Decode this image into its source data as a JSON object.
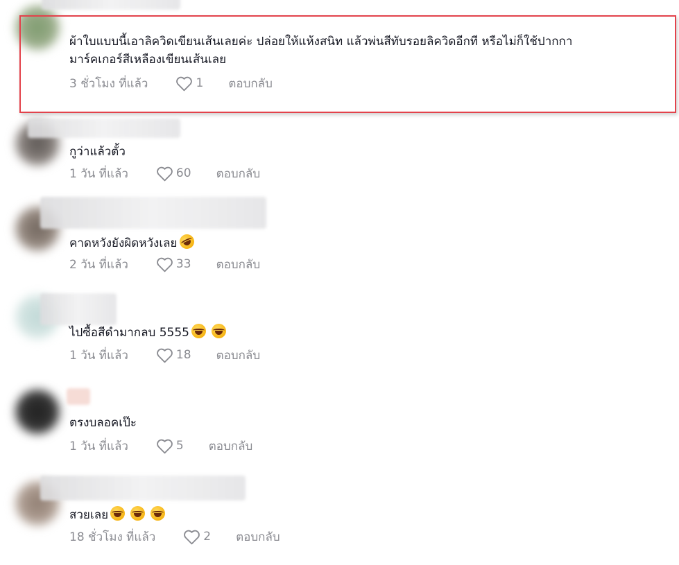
{
  "comments": [
    {
      "text_line1": "ผ้าใบแบบนี้เอาลิควิดเขียนเส้นเลยค่ะ ปล่อยให้แห้งสนิท แล้วพ่นสีทับรอยลิควิดอีกที หรือไม่ก็ใช้ปากกา",
      "text_line2": "มาร์คเกอร์สีเหลืองเขียนเส้นเลย",
      "time": "3 ชั่วโมง ที่แล้ว",
      "likes": "1",
      "reply": "ตอบกลับ"
    },
    {
      "text": "กูว่าแล้วตั้ว",
      "time": "1 วัน ที่แล้ว",
      "likes": "60",
      "reply": "ตอบกลับ"
    },
    {
      "text": "คาดหวังยังผิดหวังเลย",
      "time": "2 วัน ที่แล้ว",
      "likes": "33",
      "reply": "ตอบกลับ"
    },
    {
      "text": "ไปซื้อสีดำมากลบ 5555",
      "time": "1 วัน ที่แล้ว",
      "likes": "18",
      "reply": "ตอบกลับ"
    },
    {
      "text": "ตรงบลอคเป๊ะ",
      "time": "1 วัน ที่แล้ว",
      "likes": "5",
      "reply": "ตอบกลับ"
    },
    {
      "text": "สวยเลย",
      "time": "18 ชั่วโมง ที่แล้ว",
      "likes": "2",
      "reply": "ตอบกลับ"
    }
  ],
  "icons": {
    "like": "heart-icon",
    "emoji_rofl": "rolling-on-floor-laughing-emoji",
    "emoji_joy": "tears-of-joy-emoji"
  },
  "colors": {
    "text": "#161823",
    "meta": "#8a8b91",
    "highlight": "#e3424b"
  }
}
